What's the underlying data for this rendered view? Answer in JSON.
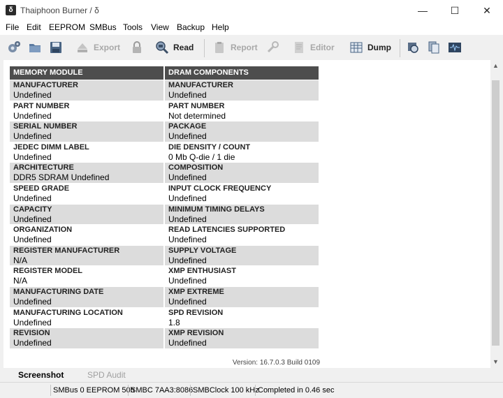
{
  "window": {
    "title": "Thaiphoon Burner / δ",
    "minimize": "—",
    "maximize": "☐",
    "close": "✕"
  },
  "menu": [
    "File",
    "Edit",
    "EEPROM",
    "SMBus",
    "Tools",
    "View",
    "Backup",
    "Help"
  ],
  "toolbar": {
    "export": "Export",
    "read": "Read",
    "report": "Report",
    "editor": "Editor",
    "dump": "Dump"
  },
  "memory_module": {
    "header": "MEMORY MODULE",
    "rows": [
      {
        "label": "MANUFACTURER",
        "value": "Undefined"
      },
      {
        "label": "PART NUMBER",
        "value": "Undefined"
      },
      {
        "label": "SERIAL NUMBER",
        "value": "Undefined"
      },
      {
        "label": "JEDEC DIMM LABEL",
        "value": "Undefined"
      },
      {
        "label": "ARCHITECTURE",
        "value": "DDR5 SDRAM Undefined"
      },
      {
        "label": "SPEED GRADE",
        "value": "Undefined"
      },
      {
        "label": "CAPACITY",
        "value": "Undefined"
      },
      {
        "label": "ORGANIZATION",
        "value": "Undefined"
      },
      {
        "label": "REGISTER MANUFACTURER",
        "value": "N/A"
      },
      {
        "label": "REGISTER MODEL",
        "value": "N/A"
      },
      {
        "label": "MANUFACTURING DATE",
        "value": "Undefined"
      },
      {
        "label": "MANUFACTURING LOCATION",
        "value": "Undefined"
      },
      {
        "label": "REVISION",
        "value": "Undefined"
      }
    ]
  },
  "dram_components": {
    "header": "DRAM COMPONENTS",
    "rows": [
      {
        "label": "MANUFACTURER",
        "value": "Undefined"
      },
      {
        "label": "PART NUMBER",
        "value": "Not determined"
      },
      {
        "label": "PACKAGE",
        "value": "Undefined"
      },
      {
        "label": "DIE DENSITY / COUNT",
        "value": "0 Mb Q-die / 1 die"
      },
      {
        "label": "COMPOSITION",
        "value": "Undefined"
      },
      {
        "label": "INPUT CLOCK FREQUENCY",
        "value": "Undefined"
      },
      {
        "label": "MINIMUM TIMING DELAYS",
        "value": "Undefined"
      },
      {
        "label": "READ LATENCIES SUPPORTED",
        "value": "Undefined"
      },
      {
        "label": "SUPPLY VOLTAGE",
        "value": "Undefined"
      },
      {
        "label": "XMP ENTHUSIAST",
        "value": "Undefined"
      },
      {
        "label": "XMP EXTREME",
        "value": "Undefined"
      },
      {
        "label": "SPD REVISION",
        "value": "1.8"
      },
      {
        "label": "XMP REVISION",
        "value": "Undefined"
      }
    ]
  },
  "version": "Version: 16.7.0.3 Build 0109",
  "tabs": {
    "screenshot": "Screenshot",
    "spd_audit": "SPD Audit"
  },
  "status": {
    "smbus": "SMBus 0 EEPROM 50h",
    "smbc": "SMBC 7AA3:8086",
    "clock": "SMBClock 100 kHz",
    "completed": "Completed in 0.46 sec"
  },
  "colors": {
    "header_bg": "#4d4d4d",
    "row_alt": "#dcdcdc"
  }
}
